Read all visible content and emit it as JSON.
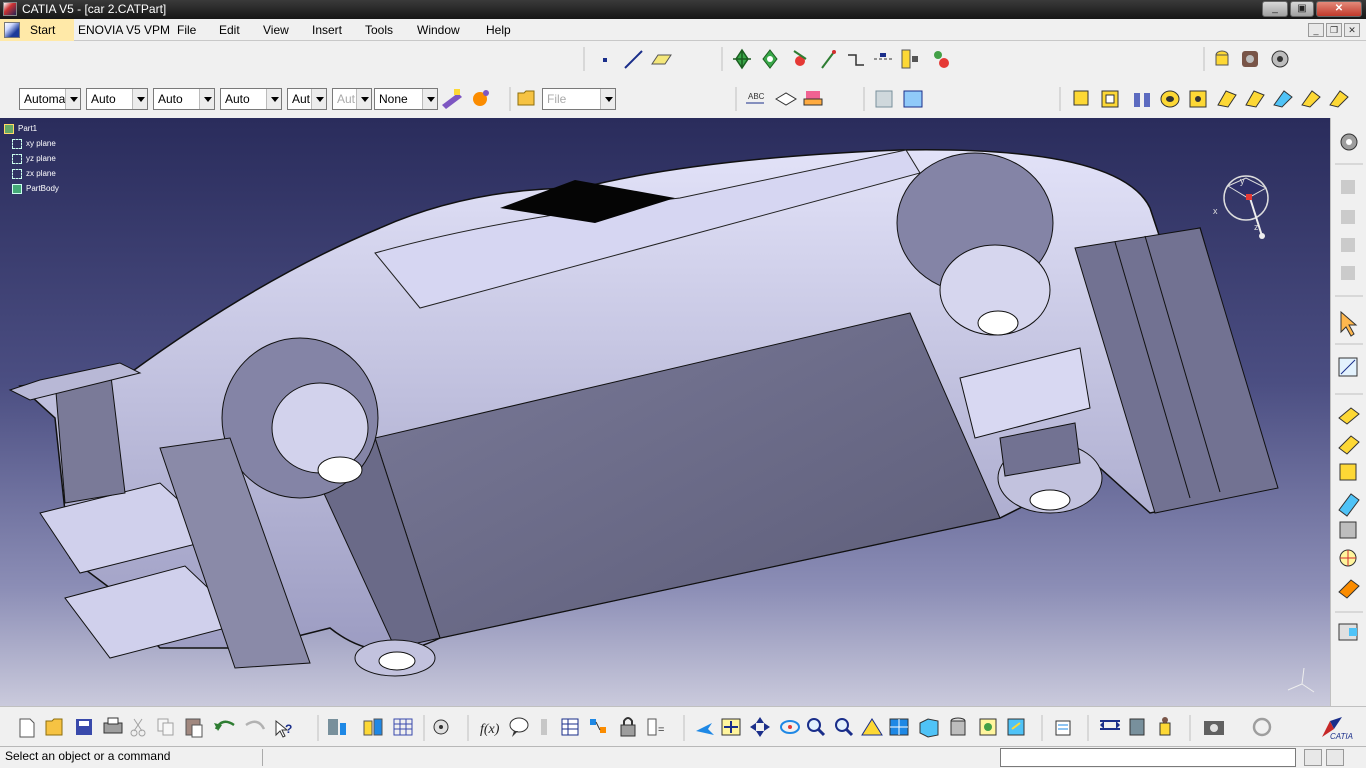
{
  "window": {
    "title": "CATIA V5 - [car 2.CATPart]"
  },
  "menu": {
    "start": "Start",
    "items": [
      "ENOVIA V5 VPM",
      "File",
      "Edit",
      "View",
      "Insert",
      "Tools",
      "Window",
      "Help"
    ]
  },
  "properties_toolbar": {
    "fields": [
      {
        "value": "Automa",
        "disabled": false
      },
      {
        "value": "Auto",
        "disabled": false
      },
      {
        "value": "Auto",
        "disabled": false
      },
      {
        "value": "Auto",
        "disabled": false
      },
      {
        "value": "Aut",
        "disabled": false
      },
      {
        "value": "Aut",
        "disabled": true
      },
      {
        "value": "None",
        "disabled": false
      }
    ],
    "file_combo": "File"
  },
  "spec_tree": {
    "root": "Part1",
    "items": [
      "xy plane",
      "yz plane",
      "zx plane",
      "PartBody"
    ]
  },
  "compass_axes": {
    "x": "x",
    "y": "y",
    "z": "z"
  },
  "status": {
    "message": "Select an object or a command"
  },
  "colors": {
    "title_bar": "#1c1c1c",
    "viewport_top": "#2a2c5c",
    "viewport_bottom": "#cacadc",
    "model_light": "#c8c8ec",
    "model_dark": "#6a6a88",
    "start_highlight": "#ffe9a8"
  },
  "icons": {
    "top_row": [
      "point-icon",
      "line-icon",
      "plane-icon",
      "compass-move-icon",
      "compass-rotate-icon",
      "snap-icon",
      "axis-icon",
      "constraint-icon",
      "measure-icon",
      "catalog-icon",
      "knowledge-icon",
      "material-icon"
    ],
    "second_row": [
      "painter-icon",
      "apply-material-icon",
      "open-folder-icon",
      "annotation-icon",
      "flag-note-icon",
      "publish-icon",
      "macro-icon",
      "table-icon",
      "pad-icon",
      "pocket-icon",
      "shaft-icon",
      "hole-icon",
      "rib-icon",
      "slot-icon",
      "stiffener-icon",
      "multi-section-icon",
      "remove-icon"
    ],
    "right_column": [
      "settings-icon",
      "sketch-icon",
      "sketch-icon-2",
      "sketch-icon-3",
      "sketch-icon-4",
      "select-arrow-icon",
      "sketcher-icon",
      "fillet-icon",
      "chamfer-icon",
      "draft-icon",
      "shell-icon",
      "thickness-icon",
      "hole-feature-icon",
      "boolean-icon",
      "transform-icon"
    ],
    "bottom_row": [
      "new-icon",
      "open-icon",
      "save-icon",
      "print-icon",
      "cut-icon",
      "copy-icon",
      "paste-icon",
      "undo-icon",
      "redo-icon",
      "whats-this-icon",
      "tools-icon",
      "tools-palette-icon",
      "grid-icon",
      "fit-all-icon",
      "formula-icon",
      "comment-icon",
      "knowledge-expert-icon",
      "table-icon",
      "graph-icon",
      "lock-icon",
      "reaction-icon",
      "fly-icon",
      "fit-icon",
      "pan-icon",
      "rotate-icon",
      "zoom-in-icon",
      "zoom-out-icon",
      "normal-view-icon",
      "multi-view-icon",
      "iso-view-icon",
      "shading-icon",
      "hide-show-icon",
      "swap-icon",
      "properties-icon",
      "measure-between-icon",
      "measure-item-icon",
      "mass-icon",
      "capture-icon",
      "update-icon",
      "catia-logo"
    ]
  }
}
